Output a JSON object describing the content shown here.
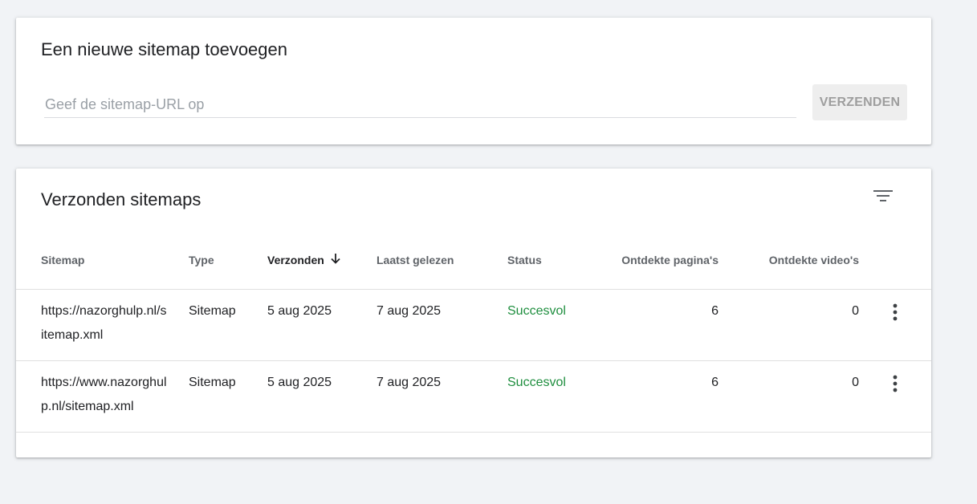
{
  "add_sitemap": {
    "title": "Een nieuwe sitemap toevoegen",
    "input_placeholder": "Geef de sitemap-URL op",
    "input_value": "",
    "submit_label": "VERZENDEN"
  },
  "submitted_sitemaps": {
    "title": "Verzonden sitemaps",
    "filter_icon": "filter-icon",
    "sort_icon": "arrow-down-icon",
    "more_icon": "more-vert-icon",
    "columns": {
      "sitemap": "Sitemap",
      "type": "Type",
      "submitted": "Verzonden",
      "last_read": "Laatst gelezen",
      "status": "Status",
      "discovered_pages": "Ontdekte pagina's",
      "discovered_videos": "Ontdekte video's"
    },
    "sorted_by": "Verzonden",
    "rows": [
      {
        "sitemap": "https://nazorghulp.nl/sitemap.xml",
        "type": "Sitemap",
        "submitted": "5 aug 2025",
        "last_read": "7 aug 2025",
        "status": "Succesvol",
        "discovered_pages": "6",
        "discovered_videos": "0"
      },
      {
        "sitemap": "https://www.nazorghulp.nl/sitemap.xml",
        "type": "Sitemap",
        "submitted": "5 aug 2025",
        "last_read": "7 aug 2025",
        "status": "Succesvol",
        "discovered_pages": "6",
        "discovered_videos": "0"
      }
    ]
  },
  "colors": {
    "page_background": "#f1f3f6",
    "card_background": "#ffffff",
    "status_success": "#1e8e3e",
    "button_disabled_bg": "#eeeeee",
    "button_disabled_text": "#9e9e9e",
    "header_text": "#5f6368"
  }
}
